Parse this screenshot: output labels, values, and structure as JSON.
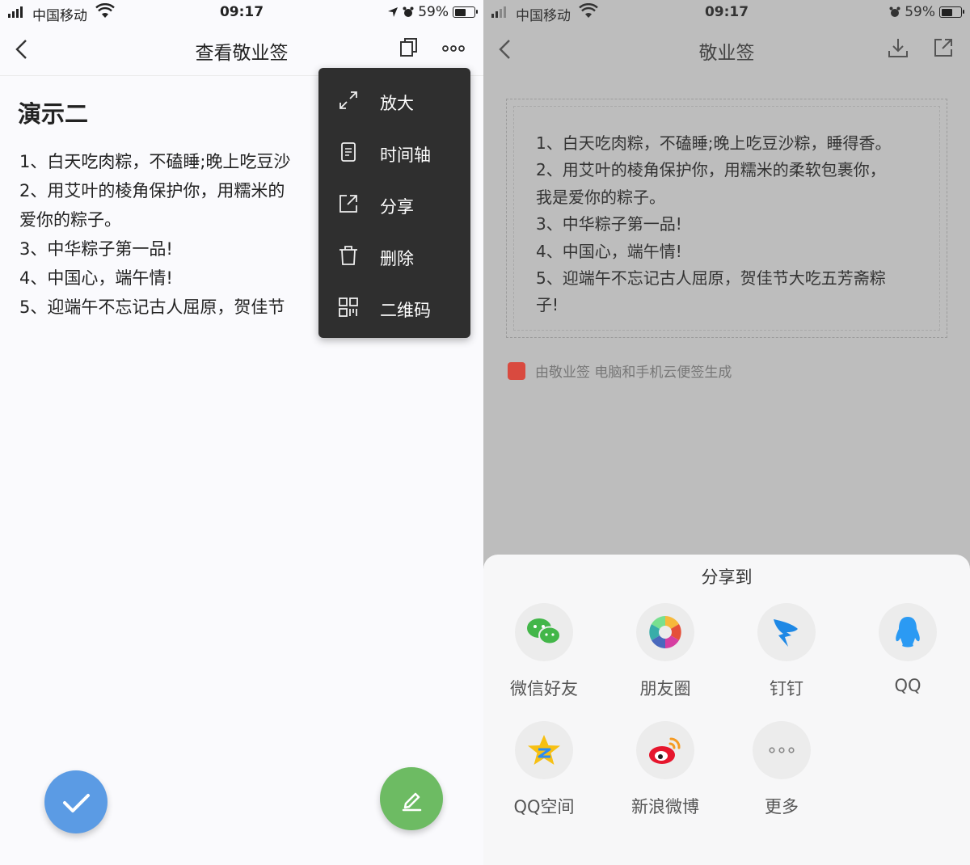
{
  "left": {
    "status": {
      "carrier": "中国移动",
      "time": "09:17",
      "battery": "59%",
      "battery_level": 0.59
    },
    "nav": {
      "title": "查看敬业签"
    },
    "note": {
      "title": "演示二",
      "lines": [
        "1、白天吃肉粽，不磕睡;晚上吃豆沙",
        "2、用艾叶的棱角保护你，用糯米的",
        "爱你的粽子。",
        "3、中华粽子第一品!",
        "4、中国心，端午情!",
        "5、迎端午不忘记古人屈原，贺佳节"
      ]
    },
    "menu": [
      {
        "label": "放大",
        "icon": "expand-icon"
      },
      {
        "label": "时间轴",
        "icon": "timeline-icon"
      },
      {
        "label": "分享",
        "icon": "share-icon"
      },
      {
        "label": "删除",
        "icon": "trash-icon"
      },
      {
        "label": "二维码",
        "icon": "qrcode-icon"
      }
    ]
  },
  "right": {
    "status": {
      "carrier": "中国移动",
      "time": "09:17",
      "battery": "59%",
      "battery_level": 0.59
    },
    "nav": {
      "title": "敬业签"
    },
    "card_lines": [
      "1、白天吃肉粽，不磕睡;晚上吃豆沙粽，睡得香。",
      "2、用艾叶的棱角保护你，用糯米的柔软包裹你，",
      "我是爱你的粽子。",
      "3、中华粽子第一品!",
      "4、中国心，端午情!",
      "5、迎端午不忘记古人屈原，贺佳节大吃五芳斋粽",
      "子!"
    ],
    "generated_by": "由敬业签 电脑和手机云便签生成",
    "share": {
      "title": "分享到",
      "items": [
        {
          "label": "微信好友",
          "icon": "wechat-icon"
        },
        {
          "label": "朋友圈",
          "icon": "moments-icon"
        },
        {
          "label": "钉钉",
          "icon": "dingtalk-icon"
        },
        {
          "label": "QQ",
          "icon": "qq-icon"
        },
        {
          "label": "QQ空间",
          "icon": "qzone-icon"
        },
        {
          "label": "新浪微博",
          "icon": "weibo-icon"
        },
        {
          "label": "更多",
          "icon": "more-icon"
        }
      ]
    }
  },
  "colors": {
    "fab_check": "#5b9be4",
    "fab_edit": "#6dbb63",
    "menu_bg": "#2f2f2f",
    "dim_overlay": "#bdbdbd"
  }
}
